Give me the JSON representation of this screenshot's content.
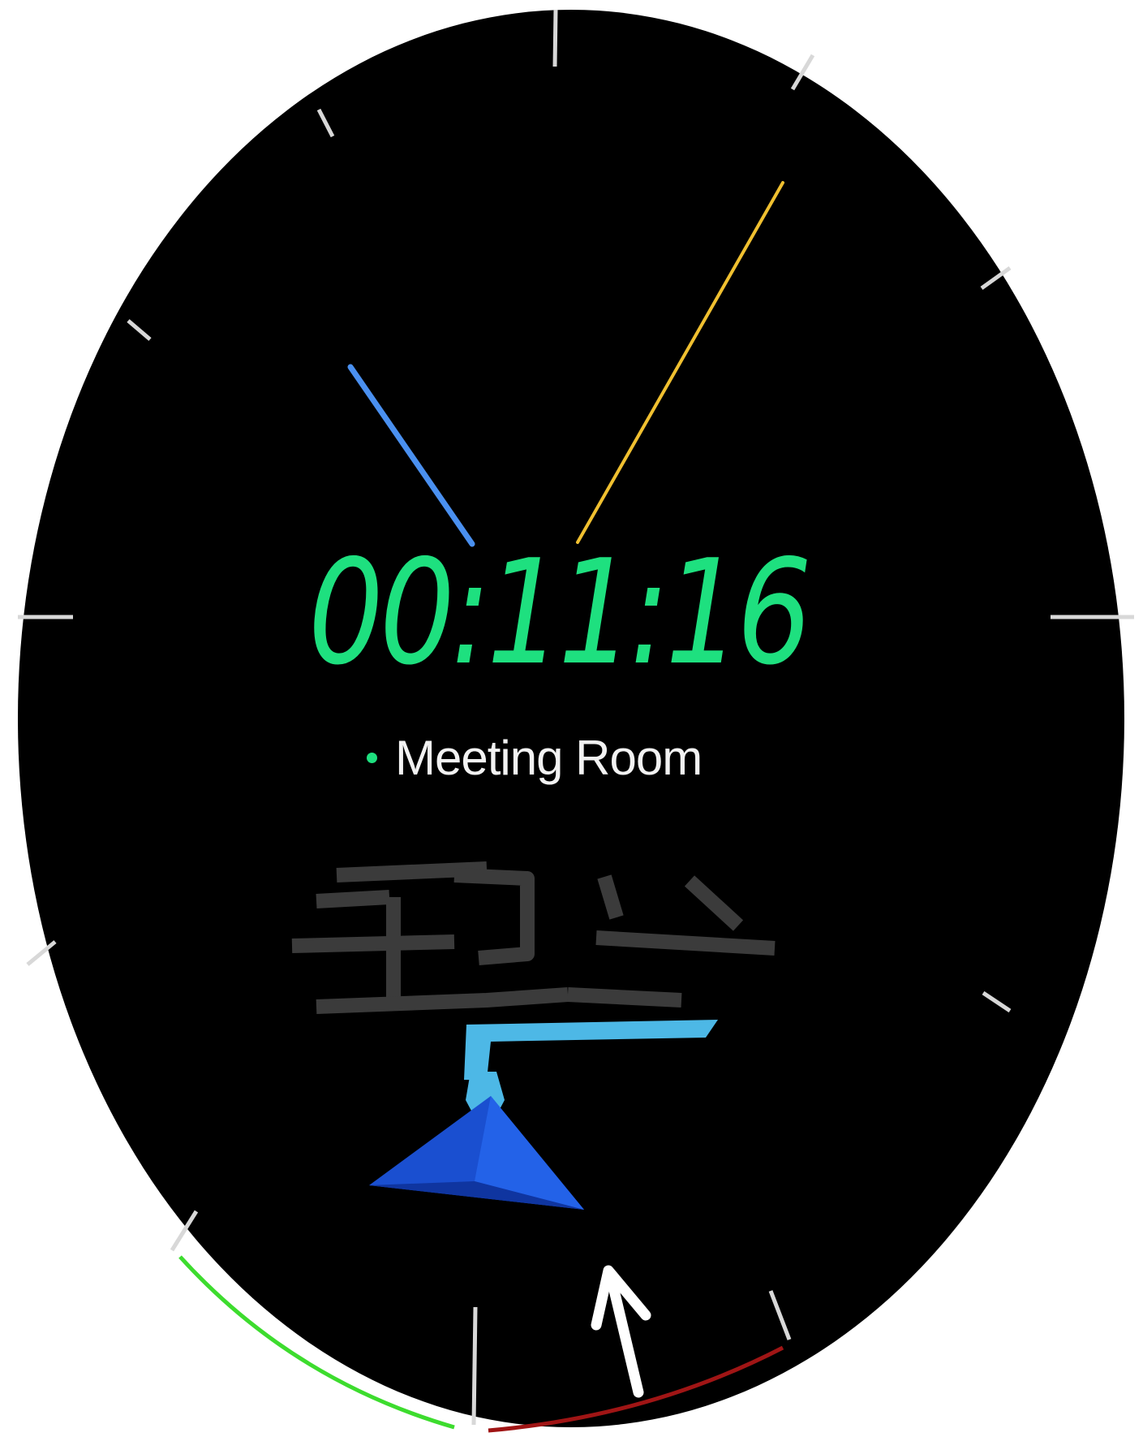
{
  "watch_face": {
    "timer_value": "00:11:16",
    "location_label": "Meeting Room",
    "status_dot_color": "#1ee07f",
    "timer_color": "#1ee07f",
    "hands": {
      "blue_hand_color": "#4a90f0",
      "yellow_hand_color": "#f0c030"
    },
    "progress_arcs": {
      "green_color": "#3ddc2e",
      "red_color": "#a01515"
    },
    "icons": {
      "navigation": "navigation-arrow-icon",
      "pointer": "pointer-arrow-icon",
      "route": "route-map-icon"
    }
  }
}
